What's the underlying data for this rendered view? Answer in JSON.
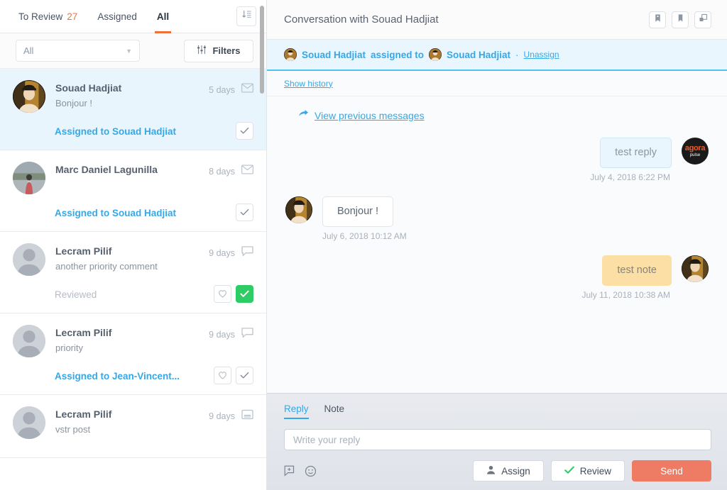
{
  "sidebar": {
    "tabs": [
      {
        "label": "To Review",
        "count": "27",
        "active": false
      },
      {
        "label": "Assigned",
        "count": "",
        "active": false
      },
      {
        "label": "All",
        "count": "",
        "active": true
      }
    ],
    "sort_icon": "sort-descending-icon",
    "filter_select_value": "All",
    "filters_label": "Filters",
    "filters_icon": "sliders-icon",
    "conversations": [
      {
        "name": "Souad Hadjiat",
        "snippet": "Bonjour !",
        "age": "5 days",
        "type_icon": "envelope-icon",
        "status": "Assigned to Souad Hadjiat",
        "status_muted": false,
        "selected": true,
        "has_heart": false,
        "check_active": false,
        "avatar": "photo-woman"
      },
      {
        "name": "Marc Daniel Lagunilla",
        "snippet": "",
        "age": "8 days",
        "type_icon": "envelope-icon",
        "status": "Assigned to Souad Hadjiat",
        "status_muted": false,
        "selected": false,
        "has_heart": false,
        "check_active": false,
        "avatar": "photo-road"
      },
      {
        "name": "Lecram Pilif",
        "snippet": "another priority comment",
        "age": "9 days",
        "type_icon": "comment-icon",
        "status": "Reviewed",
        "status_muted": true,
        "selected": false,
        "has_heart": true,
        "check_active": true,
        "avatar": "placeholder"
      },
      {
        "name": "Lecram Pilif",
        "snippet": "priority",
        "age": "9 days",
        "type_icon": "comment-icon",
        "status": "Assigned to Jean-Vincent...",
        "status_muted": false,
        "selected": false,
        "has_heart": true,
        "check_active": false,
        "avatar": "placeholder"
      },
      {
        "name": "Lecram Pilif",
        "snippet": "vstr post",
        "age": "9 days",
        "type_icon": "post-icon",
        "status": "",
        "status_muted": false,
        "selected": false,
        "has_heart": false,
        "check_active": false,
        "avatar": "placeholder"
      }
    ]
  },
  "conversation": {
    "title": "Conversation with Souad Hadjiat",
    "header_actions": [
      {
        "icon": "tag-icon",
        "name": "label-button"
      },
      {
        "icon": "bookmark-icon",
        "name": "bookmark-button"
      },
      {
        "icon": "expand-icon",
        "name": "expand-button"
      }
    ],
    "assignment": {
      "assigner": "Souad Hadjiat",
      "middle_text": "assigned to",
      "assignee": "Souad Hadjiat",
      "separator": "·",
      "unassign_label": "Unassign"
    },
    "show_history_label": "Show history",
    "view_previous_label": "View previous messages",
    "view_previous_icon": "reply-arrow-icon",
    "messages": [
      {
        "text": "test reply",
        "time": "July 4, 2018 6:22 PM",
        "direction": "out",
        "kind": "reply",
        "avatar": "agorapulse-logo"
      },
      {
        "text": "Bonjour !",
        "time": "July 6, 2018 10:12 AM",
        "direction": "in",
        "kind": "incoming",
        "avatar": "photo-woman"
      },
      {
        "text": "test note",
        "time": "July 11, 2018 10:38 AM",
        "direction": "out",
        "kind": "note",
        "avatar": "photo-woman"
      }
    ]
  },
  "composer": {
    "tabs": [
      {
        "label": "Reply",
        "active": true
      },
      {
        "label": "Note",
        "active": false
      }
    ],
    "input_value": "",
    "input_placeholder": "Write your reply",
    "tools": [
      {
        "icon": "add-comment-icon",
        "name": "add-snippet-button"
      },
      {
        "icon": "emoji-icon",
        "name": "emoji-button"
      }
    ],
    "assign_label": "Assign",
    "assign_icon": "person-icon",
    "review_label": "Review",
    "review_icon": "check-icon",
    "send_label": "Send"
  },
  "colors": {
    "accent_orange": "#f0703a",
    "link_blue": "#34a8e8",
    "banner_blue": "#e9f6fd",
    "banner_border": "#4ec3ef",
    "green": "#2ecc64",
    "send_red": "#ee7b63",
    "note_yellow": "#fbdfa5"
  }
}
